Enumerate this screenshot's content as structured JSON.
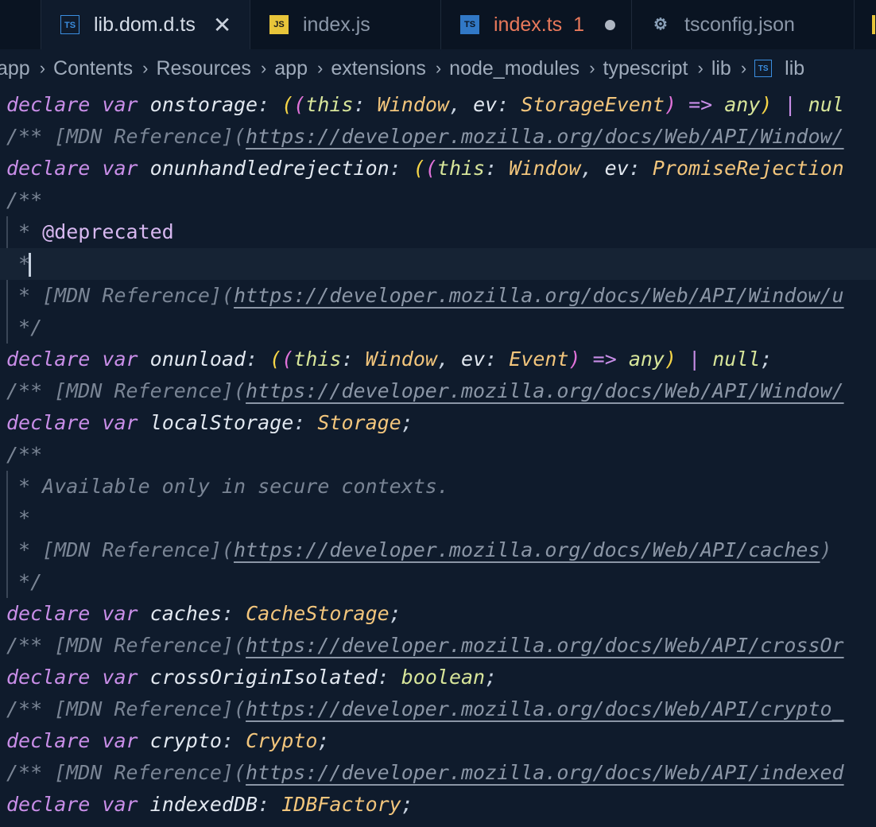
{
  "tabs": [
    {
      "label": "lib.dom.d.ts",
      "icon": "TS"
    },
    {
      "label": "index.js",
      "icon": "JS"
    },
    {
      "label": "index.ts",
      "icon": "TS",
      "problems": "1"
    },
    {
      "label": "tsconfig.json",
      "icon": "TS"
    }
  ],
  "breadcrumb": [
    "app",
    "Contents",
    "Resources",
    "app",
    "extensions",
    "node_modules",
    "typescript",
    "lib",
    "lib"
  ],
  "code": {
    "l1": {
      "kw1": "declare",
      "kw2": "var",
      "name": "onstorage",
      "this": "this",
      "t1": "Window",
      "ev": "ev",
      "t2": "StorageEvent",
      "arrow": "=>",
      "any": "any",
      "bar": "|",
      "nul": "nul"
    },
    "l2": {
      "open": "/** [MDN Reference](",
      "url": "https://developer.mozilla.org/docs/Web/API/Window/"
    },
    "l3": {
      "kw1": "declare",
      "kw2": "var",
      "name": "onunhandledrejection",
      "this": "this",
      "t1": "Window",
      "ev": "ev",
      "t2": "PromiseRejection"
    },
    "l4": {
      "text": "/**"
    },
    "l5": {
      "star": " * ",
      "tag": "@deprecated"
    },
    "l6": {
      "star": " *"
    },
    "l7": {
      "open": " * [MDN Reference](",
      "url": "https://developer.mozilla.org/docs/Web/API/Window/u"
    },
    "l8": {
      "text": " */"
    },
    "l9": {
      "kw1": "declare",
      "kw2": "var",
      "name": "onunload",
      "this": "this",
      "t1": "Window",
      "ev": "ev",
      "t2": "Event",
      "arrow": "=>",
      "any": "any",
      "bar": "|",
      "nul": "null"
    },
    "l10": {
      "open": "/** [MDN Reference](",
      "url": "https://developer.mozilla.org/docs/Web/API/Window/"
    },
    "l11": {
      "kw1": "declare",
      "kw2": "var",
      "name": "localStorage",
      "type": "Storage"
    },
    "l12": {
      "text": "/**"
    },
    "l13": {
      "text": " * Available only in secure contexts."
    },
    "l14": {
      "text": " *"
    },
    "l15": {
      "open": " * [MDN Reference](",
      "url": "https://developer.mozilla.org/docs/Web/API/caches",
      "close": ")"
    },
    "l16": {
      "text": " */"
    },
    "l17": {
      "kw1": "declare",
      "kw2": "var",
      "name": "caches",
      "type": "CacheStorage"
    },
    "l18": {
      "open": "/** [MDN Reference](",
      "url": "https://developer.mozilla.org/docs/Web/API/crossOr"
    },
    "l19": {
      "kw1": "declare",
      "kw2": "var",
      "name": "crossOriginIsolated",
      "type": "boolean"
    },
    "l20": {
      "open": "/** [MDN Reference](",
      "url": "https://developer.mozilla.org/docs/Web/API/crypto_"
    },
    "l21": {
      "kw1": "declare",
      "kw2": "var",
      "name": "crypto",
      "type": "Crypto"
    },
    "l22": {
      "open": "/** [MDN Reference](",
      "url": "https://developer.mozilla.org/docs/Web/API/indexed"
    },
    "l23": {
      "kw1": "declare",
      "kw2": "var",
      "name": "indexedDB",
      "type": "IDBFactory"
    }
  }
}
